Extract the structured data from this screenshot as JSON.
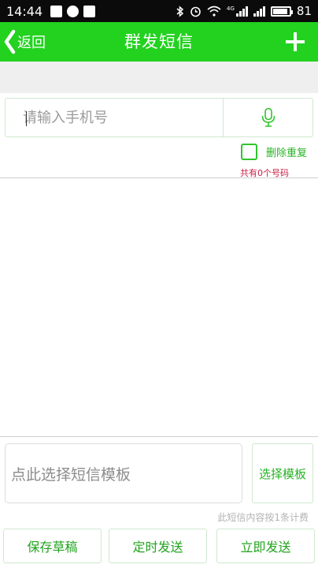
{
  "status_bar": {
    "time": "14:44",
    "network": "4G",
    "battery": "81"
  },
  "nav": {
    "back_label": "返回",
    "title": "群发短信"
  },
  "recipients": {
    "phone_placeholder": "请输入手机号",
    "dedupe_label": "删除重复",
    "count_text": "共有0个号码"
  },
  "message": {
    "template_placeholder": "点此选择短信模板",
    "select_template_label": "选择模板",
    "billing_note": "此短信内容按1条计费"
  },
  "actions": {
    "save_draft": "保存草稿",
    "timed_send": "定时发送",
    "send_now": "立即发送"
  },
  "colors": {
    "primary_green": "#22d21f",
    "text_green": "#27b324",
    "count_red": "#cc1f47"
  }
}
